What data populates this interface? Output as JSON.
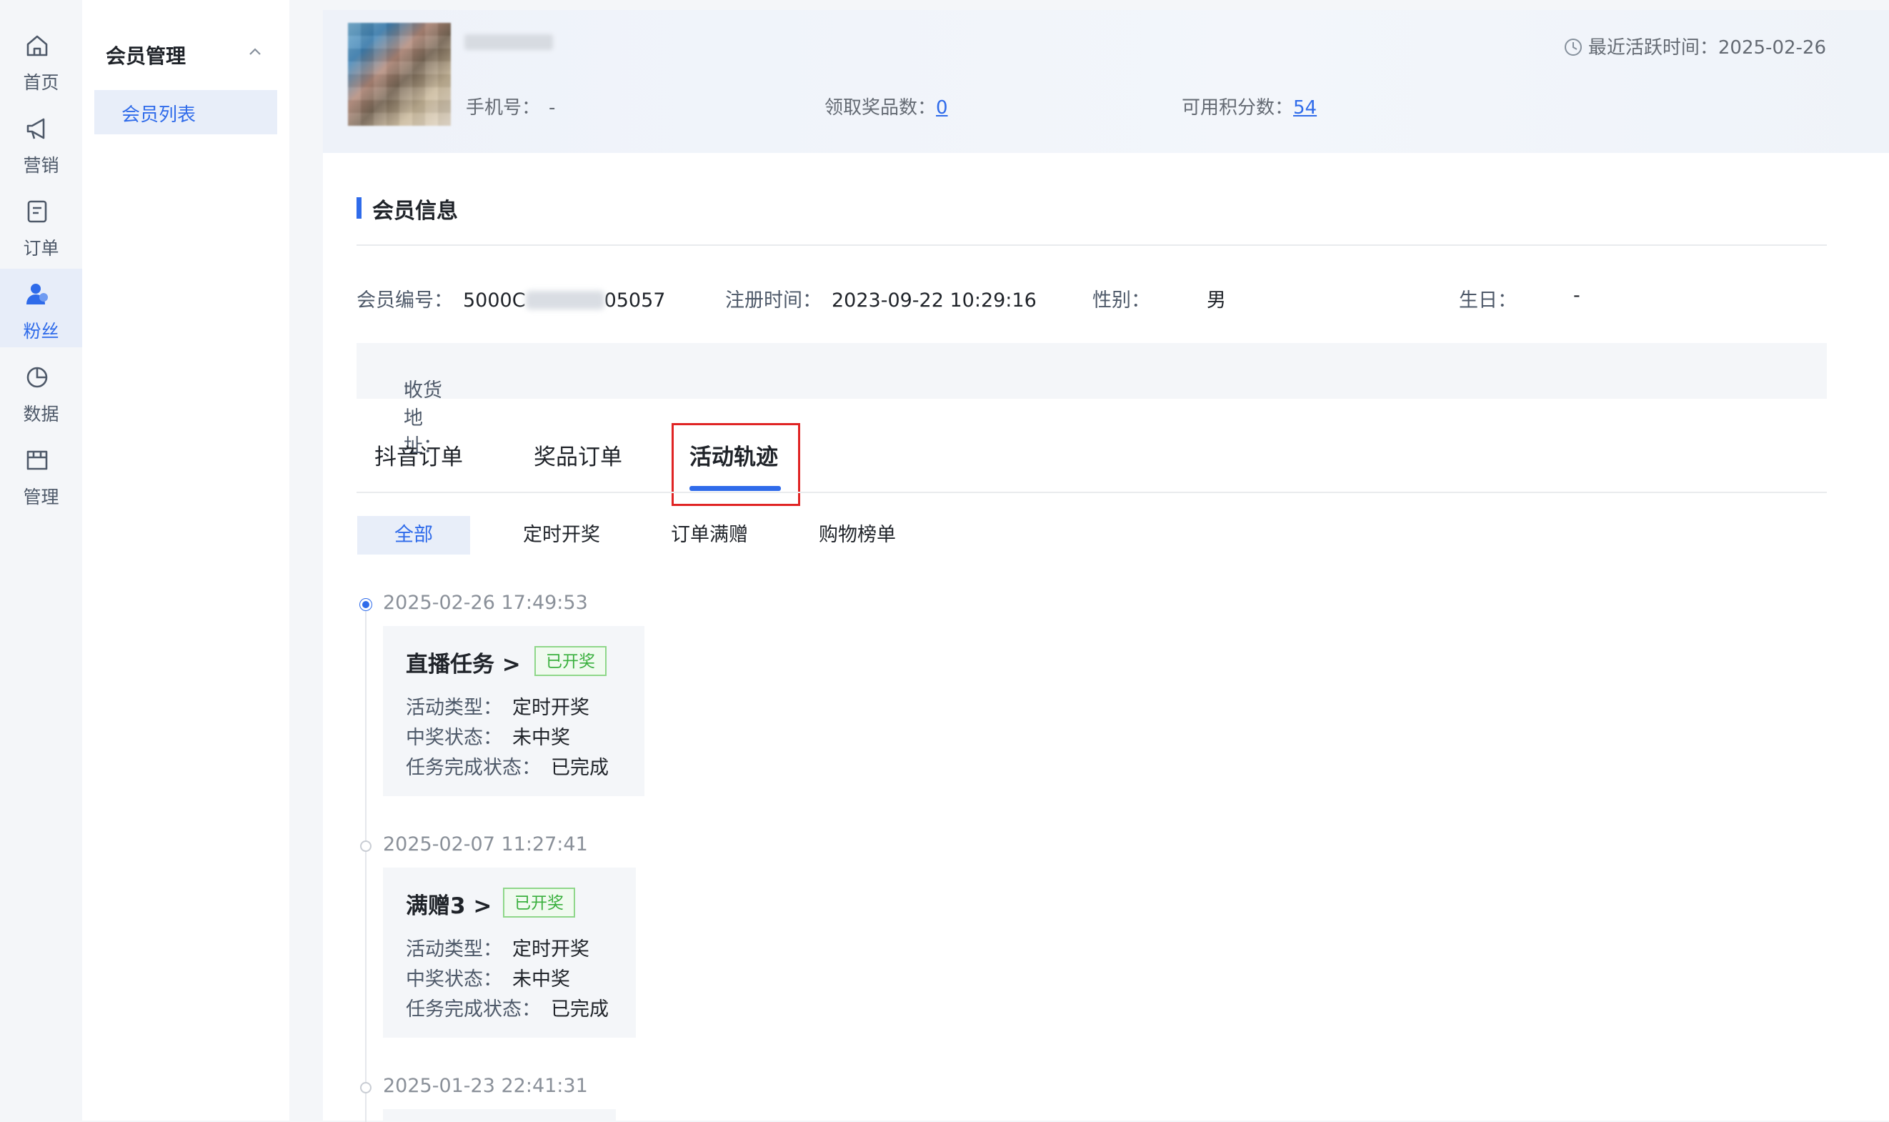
{
  "left_nav": {
    "items": [
      {
        "label": "首页",
        "icon": "home-icon",
        "active": false
      },
      {
        "label": "营销",
        "icon": "megaphone-icon",
        "active": false
      },
      {
        "label": "订单",
        "icon": "order-icon",
        "active": false
      },
      {
        "label": "粉丝",
        "icon": "fans-icon",
        "active": true
      },
      {
        "label": "数据",
        "icon": "pie-chart-icon",
        "active": false
      },
      {
        "label": "管理",
        "icon": "store-icon",
        "active": false
      }
    ]
  },
  "sub_menu": {
    "group_title": "会员管理",
    "items": [
      {
        "label": "会员列表",
        "active": true
      }
    ]
  },
  "profile": {
    "phone_label": "手机号：",
    "phone_value": "-",
    "prizes_label": "领取奖品数：",
    "prizes_value": "0",
    "points_label": "可用积分数：",
    "points_value": "54",
    "last_active_label": "最近活跃时间：",
    "last_active_value": "2025-02-26"
  },
  "member_info": {
    "section_title": "会员信息",
    "id_label": "会员编号：",
    "id_prefix": "5000C",
    "id_suffix": "05057",
    "reg_label": "注册时间：",
    "reg_value": "2023-09-22 10:29:16",
    "gender_label": "性别：",
    "gender_value": "男",
    "birthday_label": "生日：",
    "birthday_value": "-",
    "address_label": "收货地址：",
    "address_value": "-"
  },
  "tabs": [
    {
      "label": "抖音订单",
      "active": false
    },
    {
      "label": "奖品订单",
      "active": false
    },
    {
      "label": "活动轨迹",
      "active": true
    }
  ],
  "filters": [
    {
      "label": "全部",
      "active": true
    },
    {
      "label": "定时开奖",
      "active": false
    },
    {
      "label": "订单满赠",
      "active": false
    },
    {
      "label": "购物榜单",
      "active": false
    }
  ],
  "timeline": [
    {
      "time": "2025-02-26 17:49:53",
      "title": "直播任务 >",
      "badge": "已开奖",
      "rows": [
        {
          "label": "活动类型：",
          "value": "定时开奖"
        },
        {
          "label": "中奖状态：",
          "value": "未中奖"
        },
        {
          "label": "任务完成状态：",
          "value": "已完成"
        }
      ]
    },
    {
      "time": "2025-02-07 11:27:41",
      "title": "满赠3 >",
      "badge": "已开奖",
      "rows": [
        {
          "label": "活动类型：",
          "value": "定时开奖"
        },
        {
          "label": "中奖状态：",
          "value": "未中奖"
        },
        {
          "label": "任务完成状态：",
          "value": "已完成"
        }
      ]
    },
    {
      "time": "2025-01-23 22:41:31"
    }
  ],
  "colors": {
    "accent": "#2f6bea",
    "badge_green": "#3ab03e",
    "highlight_red": "#e02424"
  }
}
